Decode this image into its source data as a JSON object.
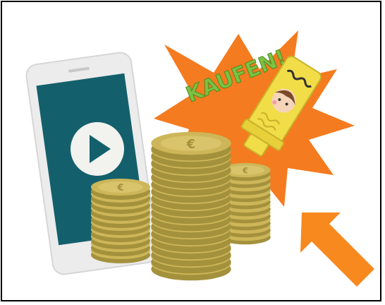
{
  "illustration": {
    "banner_text": "KAUFEN!",
    "icons": {
      "phone": "smartphone-icon",
      "play": "play-icon",
      "coins": "euro-coin-stack-icon",
      "burst": "starburst-icon",
      "tube": "cream-tube-icon",
      "arrow": "arrow-icon"
    },
    "colors": {
      "phone_body": "#f2f2f2",
      "phone_screen": "#13606c",
      "play_circle": "#f2f2ee",
      "coin": "#cdb659",
      "coin_dark": "#a4913c",
      "coin_light": "#e6d98f",
      "burst": "#f47b1f",
      "text_green": "#7cc242",
      "tube": "#f1dd47",
      "arrow": "#f7891f"
    }
  }
}
